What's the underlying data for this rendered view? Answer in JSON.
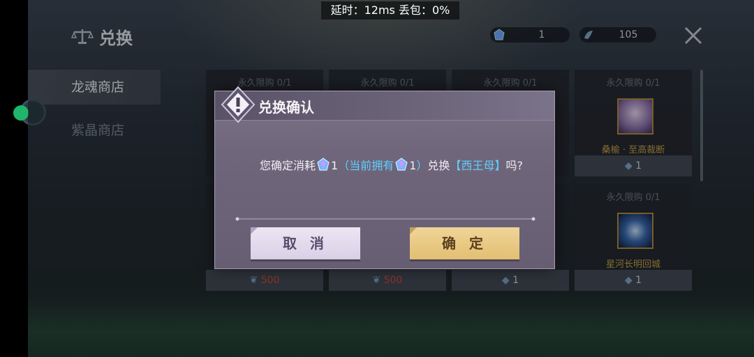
{
  "overlay": {
    "latency_text": "延时：12ms 丢包：0%"
  },
  "header": {
    "title": "兑换",
    "currencies": [
      {
        "icon": "crystal-gem-icon",
        "value": "1"
      },
      {
        "icon": "dragon-soul-icon",
        "value": "105"
      }
    ],
    "close_icon": "close-icon"
  },
  "sidebar": {
    "items": [
      {
        "label": "龙魂商店",
        "active": true
      },
      {
        "label": "紫晶商店",
        "active": false
      }
    ]
  },
  "shop": {
    "cards": [
      {
        "limit": "永久限购 0/1",
        "name": "",
        "price": "",
        "price_color": "normal"
      },
      {
        "limit": "永久限购 0/1",
        "name": "",
        "price": "",
        "price_color": "normal"
      },
      {
        "limit": "永久限购 0/1",
        "name": "",
        "price": "",
        "price_color": "normal"
      },
      {
        "limit": "永久限购 0/1",
        "name": "桑榆 · 至高裁断",
        "price": "1",
        "price_color": "normal"
      },
      {
        "limit": "",
        "name": "",
        "price": "500",
        "price_color": "red"
      },
      {
        "limit": "",
        "name": "",
        "price": "500",
        "price_color": "red"
      },
      {
        "limit": "",
        "name": "",
        "price": "1",
        "price_color": "normal"
      },
      {
        "limit": "永久限购 0/1",
        "name": "星河长明回城",
        "price": "1",
        "price_color": "normal"
      }
    ]
  },
  "dialog": {
    "title": "兑换确认",
    "msg_prefix": "您确定消耗",
    "cost": "1",
    "owned_prefix": "（当前拥有",
    "owned": "1",
    "owned_suffix": "）",
    "exchange_word": "兑换",
    "item_name": "【西王母】",
    "msg_suffix": "吗?",
    "cancel_label": "取 消",
    "confirm_label": "确 定"
  },
  "colors": {
    "highlight": "#5fd0ff",
    "confirm": "#e8c880",
    "cancel": "#e4ddee",
    "price_red": "#d24a3a"
  }
}
